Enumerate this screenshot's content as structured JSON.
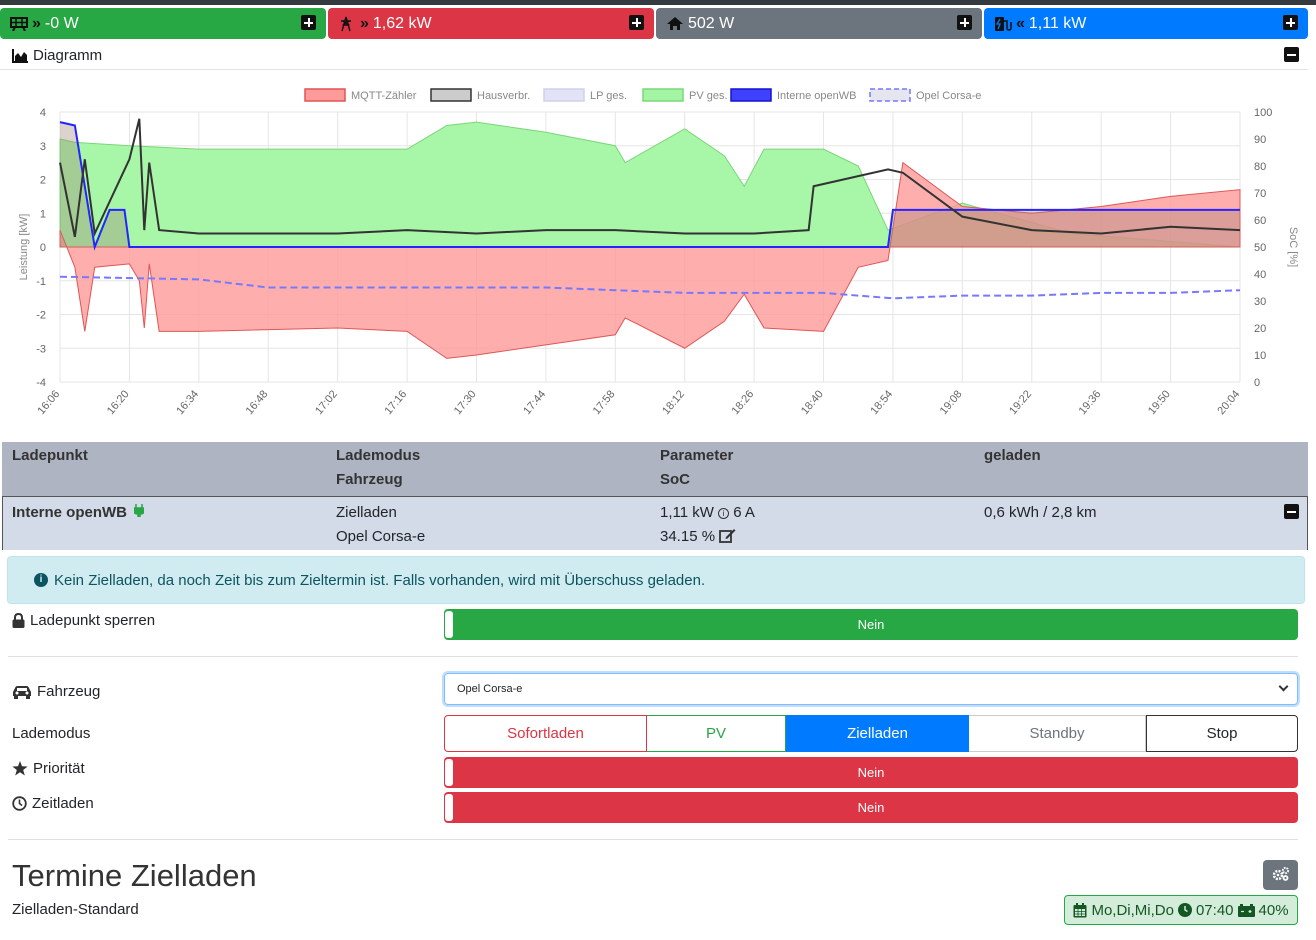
{
  "status_bar": {
    "grid": {
      "value": "-0 W",
      "color": "#28a745",
      "icon": "grid-icon"
    },
    "house_consumption": {
      "value": "1,62 kW",
      "color": "#dc3545",
      "icon": "power-pylon-icon"
    },
    "home": {
      "value": "502 W",
      "color": "#6c757d",
      "icon": "home-icon"
    },
    "charging": {
      "value": "1,11 kW",
      "color": "#007bff",
      "icon": "charging-station-icon"
    }
  },
  "diagram": {
    "title": "Diagramm"
  },
  "chart_data": {
    "type": "area",
    "legend": [
      "MQTT-Zähler",
      "Hausverbr.",
      "LP ges.",
      "PV ges.",
      "Interne openWB",
      "Opel Corsa-e"
    ],
    "legend_placement": "top",
    "ylabel": "Leistung [kW]",
    "y2label": "SoC [%]",
    "ylim": [
      -4,
      4
    ],
    "y2lim": [
      0,
      100
    ],
    "y_ticks": [
      "4",
      "3",
      "2",
      "1",
      "0",
      "-1",
      "-2",
      "-3",
      "-4"
    ],
    "y2_ticks": [
      "100",
      "90",
      "80",
      "70",
      "60",
      "50",
      "40",
      "30",
      "20",
      "10",
      "0"
    ],
    "x_ticks": [
      "16:06",
      "16:20",
      "16:34",
      "16:48",
      "17:02",
      "17:16",
      "17:30",
      "17:44",
      "17:58",
      "18:12",
      "18:26",
      "18:40",
      "18:54",
      "19:08",
      "19:22",
      "19:36",
      "19:50",
      "20:04"
    ],
    "grid": true,
    "series": [
      {
        "name": "PV ges.",
        "color": "#a3f5a3",
        "x": [
          "16:06",
          "16:09",
          "16:20",
          "16:34",
          "17:02",
          "17:16",
          "17:24",
          "17:30",
          "17:44",
          "17:58",
          "18:00",
          "18:12",
          "18:20",
          "18:24",
          "18:28",
          "18:40",
          "18:47",
          "18:53",
          "19:08",
          "19:30",
          "20:04"
        ],
        "values": [
          3.2,
          3.1,
          3.0,
          2.9,
          2.9,
          2.9,
          3.6,
          3.7,
          3.4,
          3.0,
          2.5,
          3.5,
          2.7,
          1.8,
          2.9,
          2.9,
          2.4,
          0.5,
          1.3,
          0.4,
          0.0
        ]
      },
      {
        "name": "MQTT-Zähler",
        "color": "#ff9a9a",
        "x": [
          "16:06",
          "16:09",
          "16:11",
          "16:13",
          "16:20",
          "16:22",
          "16:23",
          "16:24",
          "16:26",
          "16:34",
          "17:02",
          "17:16",
          "17:24",
          "17:30",
          "17:44",
          "17:58",
          "18:00",
          "18:12",
          "18:20",
          "18:24",
          "18:28",
          "18:40",
          "18:47",
          "18:53",
          "18:56",
          "19:08",
          "19:22",
          "19:36",
          "19:50",
          "20:04"
        ],
        "values": [
          0.5,
          -0.6,
          -2.5,
          -0.6,
          -0.5,
          -1.0,
          -2.4,
          -0.5,
          -2.5,
          -2.5,
          -2.4,
          -2.5,
          -3.3,
          -3.2,
          -2.9,
          -2.6,
          -2.1,
          -3.0,
          -2.2,
          -1.4,
          -2.4,
          -2.5,
          -0.6,
          -0.4,
          2.5,
          1.2,
          1.0,
          1.2,
          1.5,
          1.7
        ]
      },
      {
        "name": "Hausverbr.",
        "color": "#333333",
        "x": [
          "16:06",
          "16:09",
          "16:11",
          "16:13",
          "16:20",
          "16:22",
          "16:23",
          "16:24",
          "16:26",
          "16:34",
          "17:02",
          "17:16",
          "17:30",
          "17:44",
          "17:58",
          "18:12",
          "18:26",
          "18:37",
          "18:38",
          "18:47",
          "18:53",
          "18:56",
          "19:08",
          "19:22",
          "19:36",
          "19:50",
          "20:04"
        ],
        "values": [
          2.5,
          0.3,
          2.6,
          0.4,
          2.6,
          3.8,
          0.5,
          2.5,
          0.5,
          0.4,
          0.4,
          0.5,
          0.4,
          0.5,
          0.5,
          0.4,
          0.4,
          0.5,
          1.8,
          2.1,
          2.3,
          2.2,
          0.9,
          0.5,
          0.4,
          0.6,
          0.5
        ]
      },
      {
        "name": "Interne openWB",
        "color": "#2424ff",
        "x": [
          "16:06",
          "16:09",
          "16:13",
          "16:16",
          "16:19",
          "16:20",
          "16:21",
          "16:53",
          "16:54",
          "18:53",
          "18:54",
          "19:08",
          "19:22",
          "19:36",
          "19:50",
          "20:04"
        ],
        "values": [
          3.7,
          3.6,
          0.0,
          1.1,
          1.1,
          0.0,
          0.0,
          0.0,
          0.0,
          0.0,
          1.1,
          1.1,
          1.1,
          1.1,
          1.1,
          1.1
        ]
      },
      {
        "name": "Opel Corsa-e",
        "color": "#7777ff",
        "axis": "right",
        "x": [
          "16:06",
          "16:34",
          "16:48",
          "17:16",
          "17:44",
          "17:58",
          "18:12",
          "18:40",
          "18:54",
          "19:08",
          "19:22",
          "19:36",
          "19:50",
          "20:04"
        ],
        "values": [
          39,
          38,
          35,
          35,
          35,
          34,
          33,
          33,
          31,
          32,
          32,
          33,
          33,
          34
        ]
      }
    ]
  },
  "table": {
    "headers": {
      "ladepunkt": "Ladepunkt",
      "lademodus": "Lademodus",
      "fahrzeug": "Fahrzeug",
      "parameter": "Parameter",
      "soc": "SoC",
      "geladen": "geladen"
    },
    "row": {
      "name": "Interne openWB",
      "mode": "Zielladen",
      "vehicle": "Opel Corsa-e",
      "power": "1,11 kW",
      "current": "6 A",
      "soc": "34.15 %",
      "charged": "0,6 kWh / 2,8 km"
    }
  },
  "info_message": "Kein Zielladen, da noch Zeit bis zum Zieltermin ist. Falls vorhanden, wird mit Überschuss geladen.",
  "settings": {
    "lock_label": "Ladepunkt sperren",
    "lock_value": "Nein",
    "vehicle_label": "Fahrzeug",
    "vehicle_selected": "Opel Corsa-e",
    "mode_label": "Lademodus",
    "modes": [
      "Sofortladen",
      "PV",
      "Zielladen",
      "Standby",
      "Stop"
    ],
    "active_mode": "Zielladen",
    "priority_label": "Priorität",
    "priority_value": "Nein",
    "timer_label": "Zeitladen",
    "timer_value": "Nein"
  },
  "termine": {
    "title": "Termine Zielladen",
    "name": "Zielladen-Standard",
    "days": "Mo,Di,Mi,Do",
    "time": "07:40",
    "soc": "40%"
  }
}
